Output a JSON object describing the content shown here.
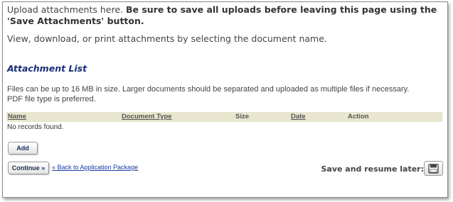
{
  "intro": {
    "text_plain": "Upload attachments here. ",
    "text_bold": "Be sure to save all uploads before leaving this page using the 'Save Attachments' button.",
    "view_text": "View, download, or print attachments by selecting the document name."
  },
  "attachments": {
    "title": "Attachment List",
    "note_line1": "Files can be up to 16 MB in size. Larger documents should be separated and uploaded as multiple files if necessary.",
    "note_line2": "PDF file type is preferred.",
    "columns": {
      "name": "Name",
      "document_type": "Document Type",
      "size": "Size",
      "date": "Date",
      "action": "Action"
    },
    "empty_message": "No records found."
  },
  "buttons": {
    "add": "Add",
    "continue": "Continue »",
    "back_link": "« Back to Application Package"
  },
  "save_resume": {
    "label": "Save and resume later:",
    "icon": "floppy-disk-icon"
  },
  "colors": {
    "section_title": "#1a2f7a",
    "table_header_bg": "#e8e6cf",
    "link": "#1a3aa0"
  }
}
